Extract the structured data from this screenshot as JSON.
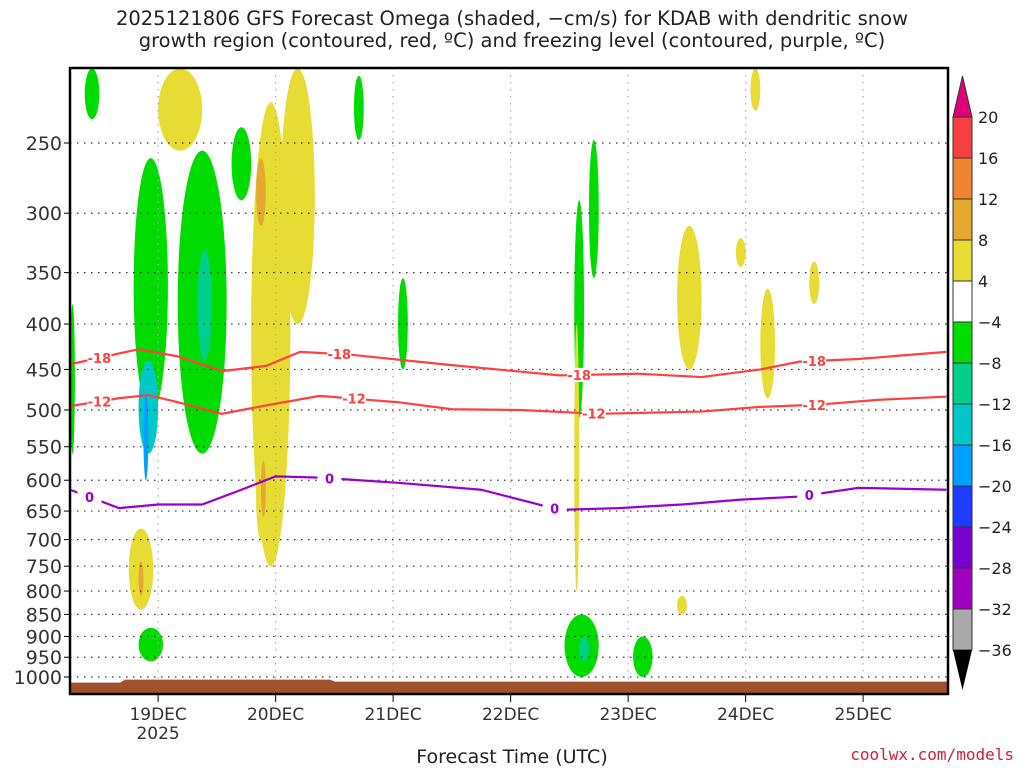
{
  "chart_data": {
    "type": "heatmap",
    "title_line1": "2025121806 GFS Forecast Omega (shaded, −cm/s) for KDAB with dendritic snow",
    "title_line2": "growth region (contoured, red, ºC) and freezing level (contoured, purple, ºC)",
    "xlabel": "Forecast Time (UTC)",
    "credit": "coolwx.com/models",
    "x_unit": "hours since 2025-12-18 06Z",
    "xlim": [
      0,
      180
    ],
    "x_ticks": [
      {
        "hour": 18,
        "label": "19DEC",
        "sub": "2025"
      },
      {
        "hour": 42,
        "label": "20DEC"
      },
      {
        "hour": 66,
        "label": "21DEC"
      },
      {
        "hour": 90,
        "label": "22DEC"
      },
      {
        "hour": 114,
        "label": "23DEC"
      },
      {
        "hour": 138,
        "label": "24DEC"
      },
      {
        "hour": 162,
        "label": "25DEC"
      }
    ],
    "y_unit": "hPa",
    "ylim": [
      1030,
      206
    ],
    "y_ticks": [
      250,
      300,
      350,
      400,
      450,
      500,
      550,
      600,
      650,
      700,
      750,
      800,
      850,
      900,
      950,
      1000
    ],
    "colorbar": {
      "top_color": "#e0007a",
      "bottom_color": "#000000",
      "labels": [
        "20",
        "16",
        "12",
        "8",
        "4",
        "−4",
        "−8",
        "−12",
        "−16",
        "−20",
        "−24",
        "−28",
        "−32",
        "−36"
      ],
      "bins": [
        {
          "level": "16",
          "color": "#f44040"
        },
        {
          "level": "12",
          "color": "#ef8530"
        },
        {
          "level": "8",
          "color": "#e4aa30"
        },
        {
          "level": "4",
          "color": "#e6dc33"
        },
        {
          "level": "0",
          "color": "#ffffff"
        },
        {
          "level": "-8",
          "color": "#00dc00"
        },
        {
          "level": "-12",
          "color": "#00d08a"
        },
        {
          "level": "-16",
          "color": "#00c8c8"
        },
        {
          "level": "-20",
          "color": "#00a0ff"
        },
        {
          "level": "-24",
          "color": "#1e3cff"
        },
        {
          "level": "-28",
          "color": "#7800d0"
        },
        {
          "level": "-32",
          "color": "#a000c0"
        },
        {
          "level": "-36",
          "color": "#aaaaaa"
        }
      ]
    },
    "shaded_regions": [
      {
        "t": [
          13,
          20
        ],
        "p": [
          260,
          505
        ],
        "level": "-8"
      },
      {
        "t": [
          14,
          18
        ],
        "p": [
          440,
          560
        ],
        "level": "-16"
      },
      {
        "t": [
          15,
          16
        ],
        "p": [
          480,
          600
        ],
        "level": "-20"
      },
      {
        "t": [
          22,
          32
        ],
        "p": [
          255,
          560
        ],
        "level": "-8"
      },
      {
        "t": [
          26,
          29
        ],
        "p": [
          330,
          440
        ],
        "level": "-12"
      },
      {
        "t": [
          3,
          6
        ],
        "p": [
          206,
          235
        ],
        "level": "-8"
      },
      {
        "t": [
          33,
          37
        ],
        "p": [
          240,
          290
        ],
        "level": "-8"
      },
      {
        "t": [
          37,
          45
        ],
        "p": [
          225,
          750
        ],
        "level": "4"
      },
      {
        "t": [
          38,
          40
        ],
        "p": [
          260,
          310
        ],
        "level": "8"
      },
      {
        "t": [
          43,
          50
        ],
        "p": [
          206,
          400
        ],
        "level": "4"
      },
      {
        "t": [
          18,
          27
        ],
        "p": [
          206,
          255
        ],
        "level": "4"
      },
      {
        "t": [
          58,
          60
        ],
        "p": [
          210,
          248
        ],
        "level": "-8"
      },
      {
        "t": [
          67,
          69
        ],
        "p": [
          355,
          450
        ],
        "level": "-8"
      },
      {
        "t": [
          103,
          105
        ],
        "p": [
          290,
          510
        ],
        "level": "-8"
      },
      {
        "t": [
          103,
          104
        ],
        "p": [
          400,
          800
        ],
        "level": "4"
      },
      {
        "t": [
          106,
          108
        ],
        "p": [
          248,
          355
        ],
        "level": "-8"
      },
      {
        "t": [
          124,
          129
        ],
        "p": [
          310,
          450
        ],
        "level": "4"
      },
      {
        "t": [
          136,
          138
        ],
        "p": [
          320,
          345
        ],
        "level": "4"
      },
      {
        "t": [
          141,
          144
        ],
        "p": [
          365,
          485
        ],
        "level": "4"
      },
      {
        "t": [
          151,
          153
        ],
        "p": [
          340,
          380
        ],
        "level": "4"
      },
      {
        "t": [
          139,
          141
        ],
        "p": [
          206,
          230
        ],
        "level": "4"
      },
      {
        "t": [
          14,
          19
        ],
        "p": [
          880,
          960
        ],
        "level": "-8"
      },
      {
        "t": [
          101,
          108
        ],
        "p": [
          850,
          1000
        ],
        "level": "-8"
      },
      {
        "t": [
          104,
          106
        ],
        "p": [
          900,
          960
        ],
        "level": "-12"
      },
      {
        "t": [
          115,
          119
        ],
        "p": [
          900,
          1000
        ],
        "level": "-8"
      },
      {
        "t": [
          12,
          17
        ],
        "p": [
          680,
          840
        ],
        "level": "4"
      },
      {
        "t": [
          14,
          15
        ],
        "p": [
          740,
          810
        ],
        "level": "8"
      },
      {
        "t": [
          38,
          40
        ],
        "p": [
          555,
          700
        ],
        "level": "4"
      },
      {
        "t": [
          39,
          40
        ],
        "p": [
          570,
          660
        ],
        "level": "8"
      },
      {
        "t": [
          124,
          126
        ],
        "p": [
          810,
          850
        ],
        "level": "4"
      },
      {
        "t": [
          0,
          1
        ],
        "p": [
          380,
          560
        ],
        "level": "-8"
      }
    ],
    "contours": [
      {
        "name": "-18",
        "label": "-18",
        "color": "#ff4040",
        "hours": [
          0,
          14,
          22,
          31,
          40,
          47,
          57,
          78,
          100,
          116,
          129,
          141,
          149,
          161,
          179
        ],
        "pressure": [
          444,
          427,
          435,
          452,
          446,
          430,
          433,
          445,
          457,
          455,
          459,
          450,
          441,
          438,
          430
        ],
        "label_hours": [
          6,
          55,
          104,
          152
        ]
      },
      {
        "name": "-12",
        "label": "-12",
        "color": "#ff4040",
        "hours": [
          0,
          10,
          16,
          22,
          31,
          41,
          51,
          67,
          78,
          92,
          108,
          129,
          141,
          153,
          165,
          179
        ],
        "pressure": [
          495,
          485,
          481,
          490,
          505,
          493,
          482,
          490,
          499,
          500,
          505,
          502,
          496,
          493,
          487,
          483
        ],
        "label_hours": [
          6,
          58,
          107,
          152
        ]
      },
      {
        "name": "0",
        "label": "0",
        "color": "#9900cc",
        "hours": [
          0,
          10,
          18,
          27,
          35,
          42,
          51,
          67,
          84,
          100,
          112,
          125,
          137,
          149,
          161,
          179
        ],
        "pressure": [
          615,
          645,
          639,
          639,
          615,
          594,
          596,
          604,
          615,
          648,
          645,
          639,
          631,
          626,
          612,
          615
        ],
        "label_hours": [
          4,
          53,
          99,
          151
        ]
      }
    ],
    "terrain_color": "#a0522d",
    "terrain_top_hPa": 1012
  }
}
